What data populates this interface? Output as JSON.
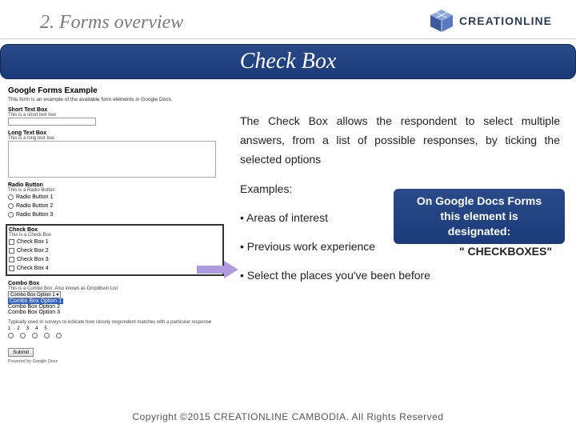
{
  "header": {
    "section_title": "2. Forms overview",
    "brand": "CREATIONLINE"
  },
  "bar": {
    "title": "Check Box"
  },
  "content": {
    "intro": "The Check Box allows the respondent to select multiple answers, from a list of possible responses, by ticking the selected options",
    "examples_label": "Examples:",
    "bullets": [
      "Areas of interest",
      "Previous work experience",
      "Select the places you've been before"
    ]
  },
  "callout": {
    "line1": "On Google Docs Forms",
    "line2": "this element is",
    "line3": "designated:",
    "value": "\" CHECKBOXES\""
  },
  "form": {
    "title": "Google Forms Example",
    "desc": "This form is an example of the available form elements in Google Docs.",
    "short": {
      "label": "Short Text Box",
      "help": "This is a short text box"
    },
    "long": {
      "label": "Long Text Box",
      "help": "This is a long text box"
    },
    "radio": {
      "label": "Radio Button",
      "help": "This is a Radio Button",
      "options": [
        "Radio Button 1",
        "Radio Button 2",
        "Radio Button 3"
      ]
    },
    "check": {
      "label": "Check Box",
      "help": "This is a Check Box",
      "options": [
        "Check Box 1",
        "Check Box 2",
        "Check Box 3",
        "Check Box 4"
      ]
    },
    "combo": {
      "label": "Combo Box",
      "help": "This is a Combo Box. Also known as Dropdown List",
      "selected": "Combo Box Option 1",
      "highlighted": "Combo Box Option 1",
      "opt2": "Combo Box Option 2",
      "opt3": "Combo Box Option 3"
    },
    "scale": {
      "help": "Typically used in surveys to indicate how closely respondent matches with a particular response",
      "nums": [
        "1",
        "2",
        "3",
        "4",
        "5"
      ]
    },
    "submit": "Submit",
    "powered": "Powered by Google Docs"
  },
  "footer": {
    "text": "Copyright ©2015 CREATIONLINE CAMBODIA. All Rights Reserved"
  }
}
